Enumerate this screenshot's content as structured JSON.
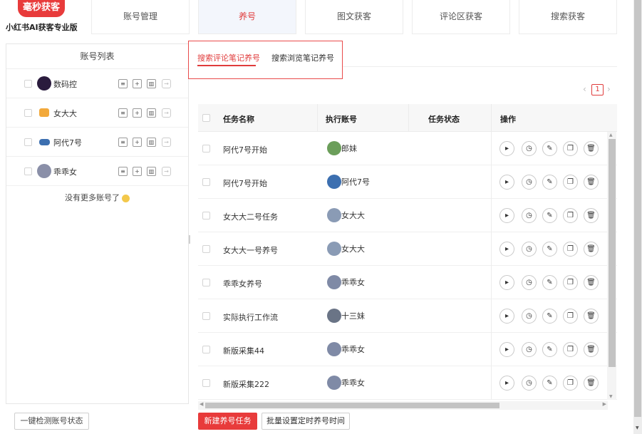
{
  "brand": {
    "badge": "毫秒获客",
    "subtitle": "小红书AI获客专业版"
  },
  "nav": [
    {
      "label": "账号管理",
      "active": false
    },
    {
      "label": "养号",
      "active": true
    },
    {
      "label": "图文获客",
      "active": false
    },
    {
      "label": "评论区获客",
      "active": false
    },
    {
      "label": "搜索获客",
      "active": false
    }
  ],
  "accounts": {
    "title": "账号列表",
    "items": [
      {
        "name": "数码控",
        "avatar_color": "#2a1b3d"
      },
      {
        "name": "女大大",
        "avatar_color": "#f2a93b"
      },
      {
        "name": "阿代7号",
        "avatar_color": "#3c6fb0"
      },
      {
        "name": "乖乖女",
        "avatar_color": "#8a8fa8"
      }
    ],
    "empty_hint": "没有更多账号了",
    "check_button": "一键检测账号状态"
  },
  "tabs": [
    {
      "label": "搜索评论笔记养号",
      "active": true
    },
    {
      "label": "搜索浏览笔记养号",
      "active": false
    }
  ],
  "pagination": {
    "prev": "‹",
    "current": "1",
    "next": "›"
  },
  "table": {
    "headers": {
      "name": "任务名称",
      "account": "执行账号",
      "status": "任务状态",
      "ops": "操作"
    },
    "rows": [
      {
        "name": "阿代7号开始",
        "account": "郎妹",
        "status": "",
        "avatar_color": "#6b9e5a"
      },
      {
        "name": "阿代7号开始",
        "account": "阿代7号",
        "status": "",
        "avatar_color": "#3c6fb0"
      },
      {
        "name": "女大大二号任务",
        "account": "女大大",
        "status": "",
        "avatar_color": "#8a9bb5"
      },
      {
        "name": "女大大一号养号",
        "account": "女大大",
        "status": "",
        "avatar_color": "#8a9bb5"
      },
      {
        "name": "乖乖女养号",
        "account": "乖乖女",
        "status": "",
        "avatar_color": "#7f8aa6"
      },
      {
        "name": "实际执行工作流",
        "account": "十三妹",
        "status": "",
        "avatar_color": "#6a7486"
      },
      {
        "name": "新版采集44",
        "account": "乖乖女",
        "status": "",
        "avatar_color": "#7f8aa6"
      },
      {
        "name": "新版采集222",
        "account": "乖乖女",
        "status": "",
        "avatar_color": "#7f8aa6"
      }
    ]
  },
  "buttons": {
    "new_task": "新建养号任务",
    "batch_schedule": "批量设置定时养号时间"
  },
  "colors": {
    "accent": "#e83b3b",
    "nav_active_bg": "#f3f6fc"
  }
}
